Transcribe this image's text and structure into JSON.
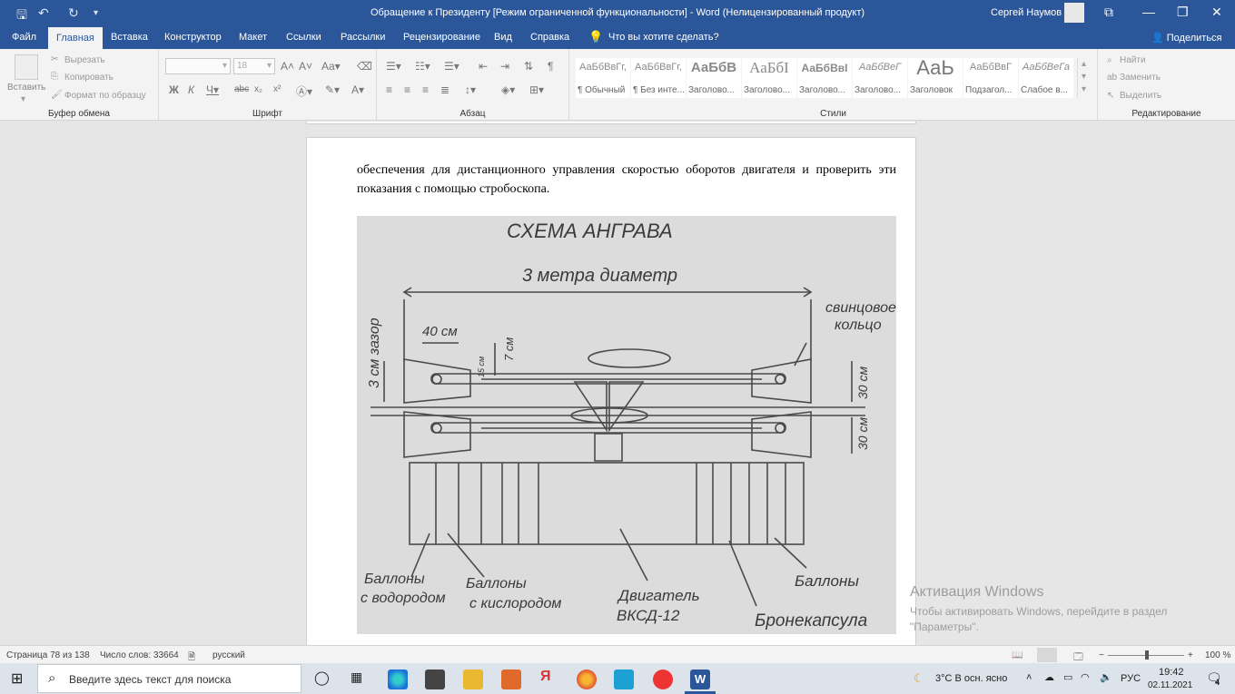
{
  "window": {
    "title": "Обращение к Президенту [Режим ограниченной функциональности]  -  Word (Нелицензированный продукт)",
    "user": "Сергей Наумов"
  },
  "tabs": [
    "Файл",
    "Главная",
    "Вставка",
    "Конструктор",
    "Макет",
    "Ссылки",
    "Рассылки",
    "Рецензирование",
    "Вид",
    "Справка"
  ],
  "active_tab": "Главная",
  "tell_me": "Что вы хотите сделать?",
  "share": "Поделиться",
  "ribbon": {
    "clipboard": {
      "paste": "Вставить",
      "cut": "Вырезать",
      "copy": "Копировать",
      "format_painter": "Формат по образцу",
      "label": "Буфер обмена"
    },
    "font": {
      "font_size": "18",
      "label": "Шрифт"
    },
    "paragraph": {
      "label": "Абзац"
    },
    "styles": {
      "label": "Стили",
      "items": [
        {
          "preview": "АаБбВвГг,",
          "name": "¶ Обычный"
        },
        {
          "preview": "АаБбВвГг,",
          "name": "¶ Без инте..."
        },
        {
          "preview": "АаБбВ",
          "name": "Заголово..."
        },
        {
          "preview": "АаБбІ",
          "name": "Заголово..."
        },
        {
          "preview": "АаБбВвІ",
          "name": "Заголово..."
        },
        {
          "preview": "АаБбВеГ",
          "name": "Заголово..."
        },
        {
          "preview": "АаЬ",
          "name": "Заголовок"
        },
        {
          "preview": "АаБбВвГ",
          "name": "Подзагол..."
        },
        {
          "preview": "АаБбВеГа",
          "name": "Слабое в..."
        }
      ]
    },
    "editing": {
      "find": "Найти",
      "replace": "Заменить",
      "select": "Выделить",
      "label": "Редактирование"
    }
  },
  "document": {
    "paragraph": "обеспечения для дистанционного управления скоростью оборотов двигателя  и проверить эти показания с помощью стробоскопа.",
    "figure": {
      "title": "СХЕМА АНГРАВА",
      "diameter": "3 метра диаметр",
      "lead_ring_1": "свинцовое",
      "lead_ring_2": "кольцо",
      "gap": "3 см зазор",
      "dim_40": "40 см",
      "dim_7": "7 см",
      "dim_15": "15 см",
      "dim_30a": "30 см",
      "dim_30b": "30 см",
      "cyl_h1": "Баллоны",
      "cyl_h2": "с водородом",
      "cyl_o1": "Баллоны",
      "cyl_o2": "с кислородом",
      "engine1": "Двигатель",
      "engine2": "ВКСД-12",
      "cyl_right": "Баллоны",
      "capsule": "Бронекапсула"
    }
  },
  "watermark": {
    "line1": "Активация Windows",
    "line2": "Чтобы активировать Windows, перейдите в раздел",
    "line3": "\"Параметры\"."
  },
  "status": {
    "page": "Страница 78 из 138",
    "words": "Число слов: 33664",
    "language": "русский",
    "zoom": "100 %"
  },
  "taskbar": {
    "search_placeholder": "Введите здесь текст для поиска",
    "weather": "3°C  В осн. ясно",
    "lang": "РУС",
    "time": "19:42",
    "date": "02.11.2021",
    "notifications": "4"
  }
}
